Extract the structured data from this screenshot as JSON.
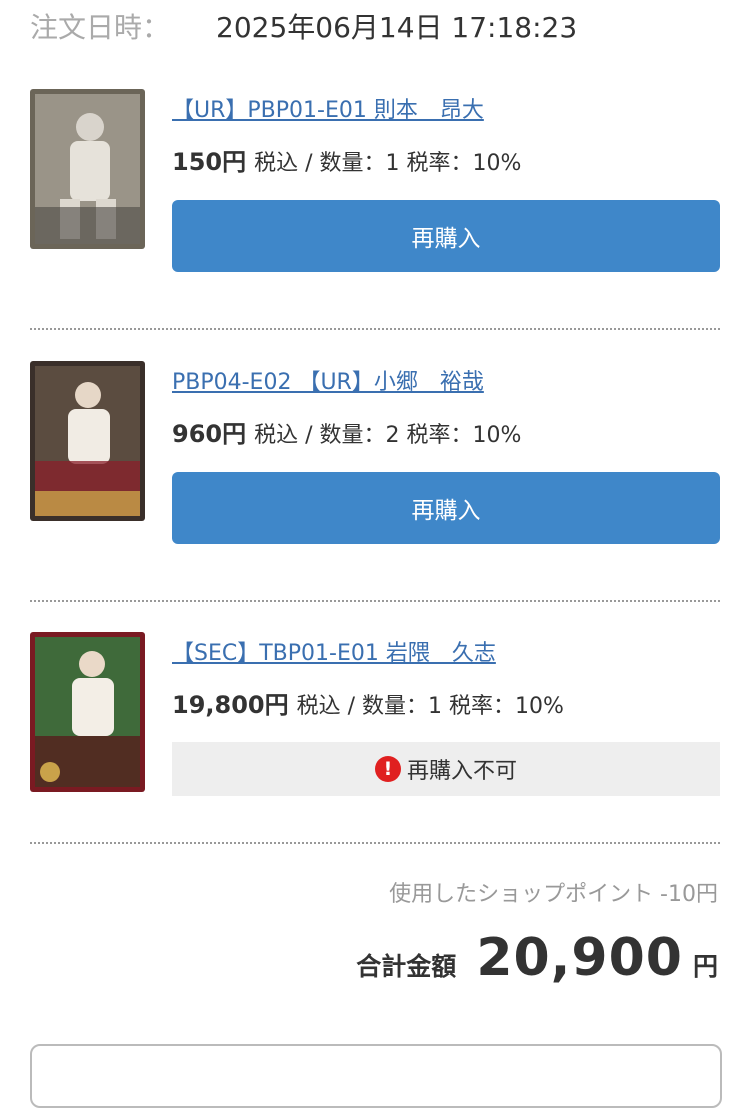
{
  "order": {
    "date_label": "注文日時：",
    "date_value": "2025年06月14日 17:18:23"
  },
  "items": [
    {
      "title": "【UR】PBP01-E01 則本　昂大",
      "price": "150円",
      "detail": "税込 / 数量：1 税率：10%",
      "action_label": "再購入",
      "card_color": "#6b6558"
    },
    {
      "title": "PBP04-E02 【UR】小郷　裕哉",
      "price": "960円",
      "detail": "税込 / 数量：2 税率：10%",
      "action_label": "再購入",
      "card_color": "#8a1f2a"
    },
    {
      "title": "【SEC】TBP01-E01 岩隈　久志",
      "price": "19,800円",
      "detail": "税込 / 数量：1 税率：10%",
      "unavailable_label": "再購入不可",
      "card_color": "#3f6a3a"
    }
  ],
  "summary": {
    "points_used": "使用したショップポイント -10円",
    "total_label": "合計金額",
    "total_value": "20,900",
    "total_unit": "円"
  },
  "colors": {
    "accent": "#3f87c9",
    "link": "#3a6fb0",
    "error": "#e02020"
  }
}
